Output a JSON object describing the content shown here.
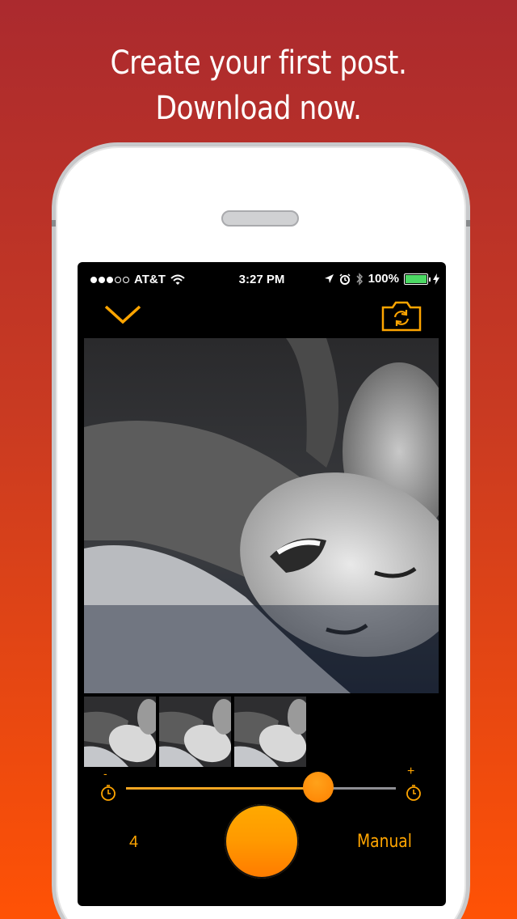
{
  "promo": {
    "line1": "Create your first post.",
    "line2": "Download now."
  },
  "status_bar": {
    "carrier": "AT&T",
    "time": "3:27 PM",
    "battery": "100%",
    "signal_bars_filled": 3,
    "signal_bars_total": 5
  },
  "toolbar": {
    "dismiss_icon": "chevron-down-icon",
    "switch_camera_icon": "camera-switch-icon"
  },
  "capture": {
    "thumbnail_count": 3,
    "slider_minus_label": "-",
    "slider_plus_label": "+",
    "slider_level": 0.69,
    "count_label": "4",
    "mode_label": "Manual"
  },
  "colors": {
    "accent": "#FFA500",
    "background_top": "#AB2A2E",
    "background_bottom": "#FF5205"
  }
}
